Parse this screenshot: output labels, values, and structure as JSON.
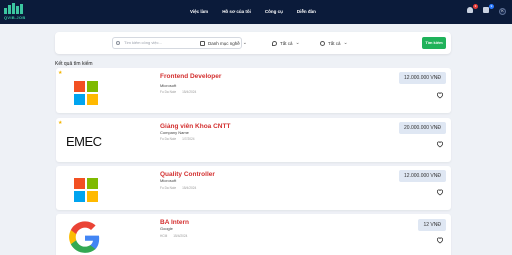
{
  "brand": {
    "logo_text": "QVIB.JOB"
  },
  "nav": [
    {
      "label": "Việc làm"
    },
    {
      "label": "Hồ sơ của tôi"
    },
    {
      "label": "Công cụ"
    },
    {
      "label": "Diễn đàn"
    }
  ],
  "header_icons": {
    "notification_count": "3",
    "message_count": "9",
    "avatar_letter": "K"
  },
  "search": {
    "placeholder": "Tìm kiếm công việc...",
    "category_label": "Danh mục nghề",
    "location_label": "Tất cả",
    "time_label": "Tất cả",
    "button_label": "Tìm kiếm"
  },
  "results_title": "Kết quả tìm kiếm",
  "jobs": [
    {
      "title": "Frontend Developer",
      "company": "Microsoft",
      "type": "Fu Da Noie",
      "date": "15/4/2024",
      "salary": "12.000.000 VNĐ",
      "logo": "microsoft",
      "starred": true
    },
    {
      "title": "Giảng viên Khoa CNTT",
      "company": "Company Name",
      "type": "Fu Da Noie",
      "date": "1/7/2024",
      "salary": "20.000.000 VNĐ",
      "logo": "emec",
      "logo_text": "EMEC",
      "starred": true
    },
    {
      "title": "Quality Controller",
      "company": "Microsoft",
      "type": "Fu Da Noie",
      "date": "15/4/2024",
      "salary": "12.000.000 VNĐ",
      "logo": "microsoft",
      "starred": false
    },
    {
      "title": "BA Intern",
      "company": "Google",
      "type": "HCM",
      "date": "15/4/2024",
      "salary": "12 VNĐ",
      "logo": "google",
      "starred": false
    }
  ],
  "colors": {
    "header_bg": "#0b1b3a",
    "accent_green": "#1fb25a",
    "job_title_red": "#d32f2f",
    "salary_bg": "#dfe7f3"
  }
}
